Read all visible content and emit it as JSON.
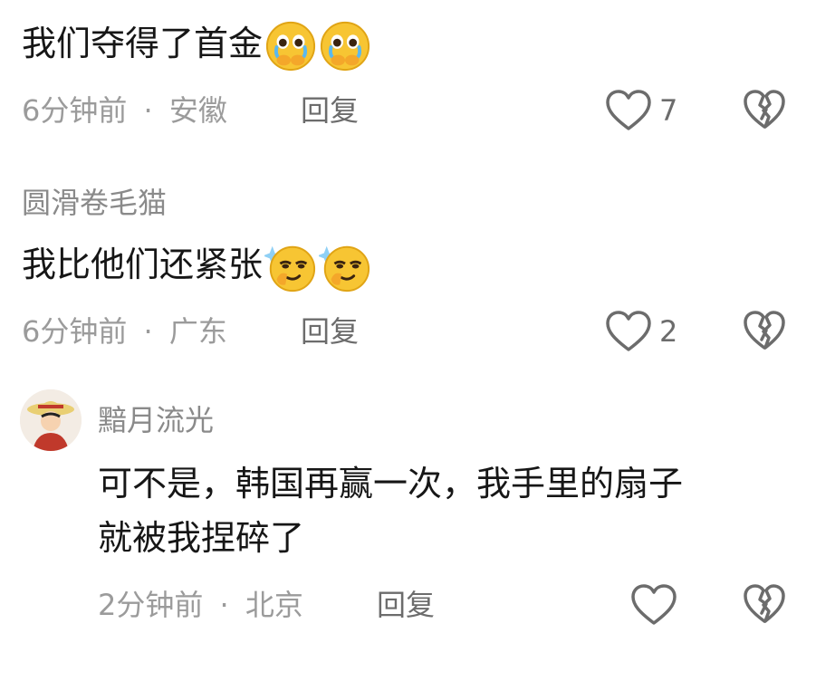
{
  "comments": [
    {
      "content": "我们夺得了首金",
      "emojis": [
        "teary-pleading-emoji",
        "teary-pleading-emoji"
      ],
      "time": "6分钟前",
      "location": "安徽",
      "reply_label": "回复",
      "like_count": "7"
    },
    {
      "username": "圆滑卷毛猫",
      "content": "我比他们还紧张",
      "emojis": [
        "smirk-sparkle-emoji",
        "smirk-sparkle-emoji"
      ],
      "time": "6分钟前",
      "location": "广东",
      "reply_label": "回复",
      "like_count": "2"
    },
    {
      "username": "黯月流光",
      "content_line1": "可不是，韩国再赢一次，我手里的扇子",
      "content_line2": "就被我捏碎了",
      "time": "2分钟前",
      "location": "北京",
      "reply_label": "回复"
    }
  ],
  "separator": "·",
  "colors": {
    "text_primary": "#161616",
    "text_secondary": "#9b9b9b",
    "icon_stroke": "#6c6c6c",
    "emoji_yellow": "#f7c533"
  }
}
